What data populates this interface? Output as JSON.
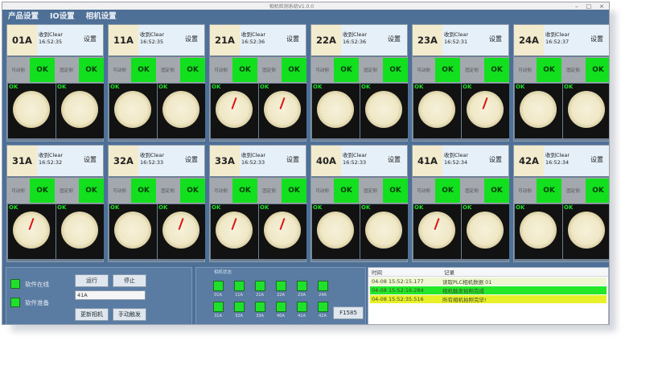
{
  "window": {
    "title": "相机检测系统V1.0.0"
  },
  "menu": [
    "产品设置",
    "IO设置",
    "相机设置"
  ],
  "stations": [
    {
      "id": "01A",
      "info": "收到Clear",
      "time": "16:52:35",
      "set": "设置",
      "left_label": "可动侧",
      "right_label": "固定侧",
      "left_status": "OK",
      "right_status": "OK",
      "left_tag": "OK",
      "right_tag": "OK",
      "needle_l": false,
      "needle_r": false
    },
    {
      "id": "11A",
      "info": "收到Clear",
      "time": "16:52:35",
      "set": "设置",
      "left_label": "可动侧",
      "right_label": "固定侧",
      "left_status": "OK",
      "right_status": "OK",
      "left_tag": "OK",
      "right_tag": "OK",
      "needle_l": false,
      "needle_r": false
    },
    {
      "id": "21A",
      "info": "收到Clear",
      "time": "16:52:36",
      "set": "设置",
      "left_label": "可动侧",
      "right_label": "固定侧",
      "left_status": "OK",
      "right_status": "OK",
      "left_tag": "OK",
      "right_tag": "OK",
      "needle_l": true,
      "needle_r": true
    },
    {
      "id": "22A",
      "info": "收到Clear",
      "time": "16:52:36",
      "set": "设置",
      "left_label": "可动侧",
      "right_label": "固定侧",
      "left_status": "OK",
      "right_status": "OK",
      "left_tag": "OK",
      "right_tag": "OK",
      "needle_l": false,
      "needle_r": false
    },
    {
      "id": "23A",
      "info": "收到Clear",
      "time": "16:52:31",
      "set": "设置",
      "left_label": "可动侧",
      "right_label": "固定侧",
      "left_status": "OK",
      "right_status": "OK",
      "left_tag": "OK",
      "right_tag": "OK",
      "needle_l": false,
      "needle_r": true
    },
    {
      "id": "24A",
      "info": "收到Clear",
      "time": "16:52:37",
      "set": "设置",
      "left_label": "可动侧",
      "right_label": "固定侧",
      "left_status": "OK",
      "right_status": "OK",
      "left_tag": "OK",
      "right_tag": "OK",
      "needle_l": false,
      "needle_r": false
    },
    {
      "id": "31A",
      "info": "收到Clear",
      "time": "16:52:32",
      "set": "设置",
      "left_label": "可动侧",
      "right_label": "固定侧",
      "left_status": "OK",
      "right_status": "OK",
      "left_tag": "OK",
      "right_tag": "OK",
      "needle_l": true,
      "needle_r": false
    },
    {
      "id": "32A",
      "info": "收到Clear",
      "time": "16:52:33",
      "set": "设置",
      "left_label": "可动侧",
      "right_label": "固定侧",
      "left_status": "OK",
      "right_status": "OK",
      "left_tag": "OK",
      "right_tag": "OK",
      "needle_l": false,
      "needle_r": true
    },
    {
      "id": "33A",
      "info": "收到Clear",
      "time": "16:52:33",
      "set": "设置",
      "left_label": "可动侧",
      "right_label": "固定侧",
      "left_status": "OK",
      "right_status": "OK",
      "left_tag": "OK",
      "right_tag": "OK",
      "needle_l": true,
      "needle_r": true
    },
    {
      "id": "40A",
      "info": "收到Clear",
      "time": "16:52:33",
      "set": "设置",
      "left_label": "可动侧",
      "right_label": "固定侧",
      "left_status": "OK",
      "right_status": "OK",
      "left_tag": "OK",
      "right_tag": "OK",
      "needle_l": false,
      "needle_r": false
    },
    {
      "id": "41A",
      "info": "收到Clear",
      "time": "16:52:34",
      "set": "设置",
      "left_label": "可动侧",
      "right_label": "固定侧",
      "left_status": "OK",
      "right_status": "OK",
      "left_tag": "OK",
      "right_tag": "OK",
      "needle_l": true,
      "needle_r": false
    },
    {
      "id": "42A",
      "info": "收到Clear",
      "time": "16:52:34",
      "set": "设置",
      "left_label": "可动侧",
      "right_label": "固定侧",
      "left_status": "OK",
      "right_status": "OK",
      "left_tag": "OK",
      "right_tag": "OK",
      "needle_l": false,
      "needle_r": false
    }
  ],
  "control": {
    "indicator1": "软件在线",
    "indicator2": "软件准备",
    "run_label": "运行",
    "stop_label": "停止",
    "input_value": "41A",
    "update_camera_label": "更新相机",
    "manual_trigger_label": "手动触发"
  },
  "mini_panel": {
    "title": "相机状态",
    "items": [
      "31A",
      "32A",
      "33A",
      "40A",
      "41A",
      "42A"
    ],
    "items_top": [
      "01A",
      "11A",
      "21A",
      "22A",
      "23A",
      "24A"
    ],
    "button_label": "F1585"
  },
  "log": {
    "col_time": "时间",
    "col_record": "记录",
    "rows": [
      {
        "time": "04-08 15:52:15.177",
        "text": "读取PLC相机数据 01",
        "color": "#eef7d2"
      },
      {
        "time": "04-08 15:52:16.284",
        "text": "相机触发拍照完成",
        "color": "#22e828"
      },
      {
        "time": "04-08 15:52:35.516",
        "text": "所有相机拍照完毕!",
        "color": "#e8f02a"
      }
    ]
  },
  "colors": {
    "ok": "#12e01f",
    "bg": "#4e6f96",
    "header": "#e6f0f8"
  }
}
